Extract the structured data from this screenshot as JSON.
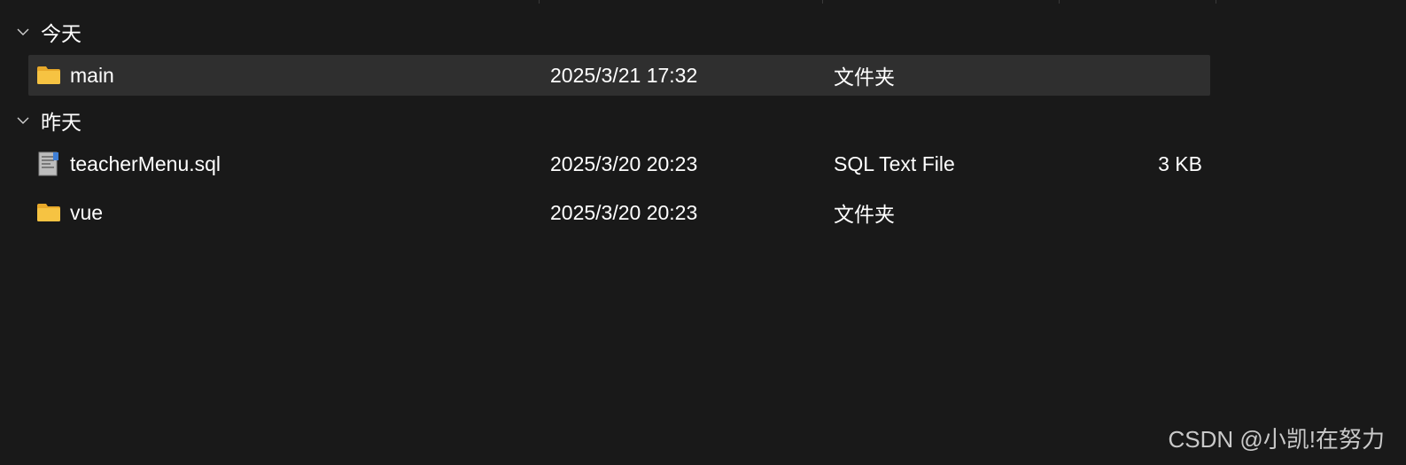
{
  "groups": [
    {
      "label": "今天",
      "items": [
        {
          "name": "main",
          "date": "2025/3/21 17:32",
          "type": "文件夹",
          "size": "",
          "icon": "folder-icon",
          "selected": true
        }
      ]
    },
    {
      "label": "昨天",
      "items": [
        {
          "name": "teacherMenu.sql",
          "date": "2025/3/20 20:23",
          "type": "SQL Text File",
          "size": "3 KB",
          "icon": "sql-file-icon",
          "selected": false
        },
        {
          "name": "vue",
          "date": "2025/3/20 20:23",
          "type": "文件夹",
          "size": "",
          "icon": "folder-icon",
          "selected": false
        }
      ]
    }
  ],
  "watermark": "CSDN @小凯!在努力",
  "colors": {
    "background": "#191919",
    "selected_row": "#2f2f2f",
    "folder_yellow": "#f6c342"
  }
}
